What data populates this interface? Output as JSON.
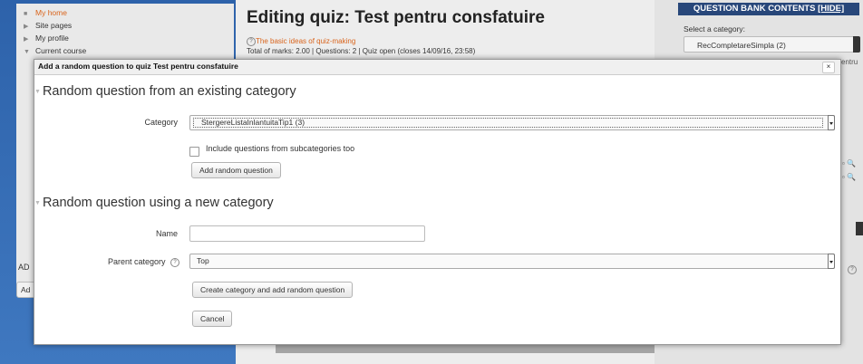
{
  "nav": {
    "items": [
      {
        "label": "My home",
        "marker": "■",
        "style": "home"
      },
      {
        "label": "Site pages",
        "marker": "▶"
      },
      {
        "label": "My profile",
        "marker": "▶"
      },
      {
        "label": "Current course",
        "marker": "▼"
      }
    ]
  },
  "page": {
    "title": "Editing quiz: Test pentru consfatuire",
    "basic_ideas_link": "The basic ideas of quiz-making",
    "marks_info": "Total of marks: 2.00 | Questions: 2 | Quiz open (closes 14/09/16, 23:58)"
  },
  "question_bank": {
    "header": "QUESTION BANK CONTENTS",
    "hide_link": "[HIDE]",
    "select_label": "Select a category:",
    "selected_category": "RecCompletareSimpla (2)"
  },
  "fragments": {
    "entru": "entru",
    "ad_label": "AD",
    "ad_button": "Ad"
  },
  "dialog": {
    "title": "Add a random question to quiz Test pentru consfatuire",
    "close": "×",
    "section1": {
      "legend": "Random question from an existing category",
      "category_label": "Category",
      "category_value": "StergereListaInlantuitaTip1 (3)",
      "subcategories_label": "Include questions from subcategories too",
      "add_button": "Add random question"
    },
    "section2": {
      "legend": "Random question using a new category",
      "name_label": "Name",
      "name_value": "",
      "parent_label": "Parent category",
      "parent_value": "Top",
      "create_button": "Create category and add random question",
      "cancel_button": "Cancel"
    }
  }
}
